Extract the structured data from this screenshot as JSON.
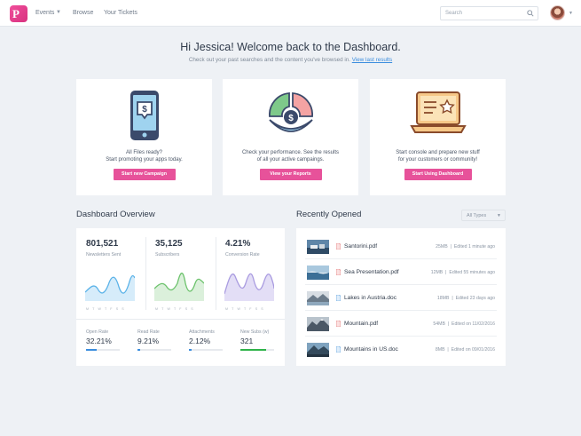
{
  "nav": {
    "items": [
      "Events",
      "Browse",
      "Your Tickets"
    ],
    "search_placeholder": "Search",
    "logo_letter": "P"
  },
  "welcome": {
    "title": "Hi Jessica! Welcome back to the Dashboard.",
    "subtitle": "Check out your past searches and the content you've browsed in.",
    "link": "View last results"
  },
  "cards": [
    {
      "line1": "All Files ready?",
      "line2": "Start promoting your apps today.",
      "button": "Start new Campaign",
      "icon": "mobile-dollar-icon"
    },
    {
      "line1": "Check your performance. See the results",
      "line2": "of all your active campaings.",
      "button": "View your Reports",
      "icon": "pie-dollar-icon"
    },
    {
      "line1": "Start console and prepare new stuff",
      "line2": "for your customers or community!",
      "button": "Start Using Dashboard",
      "icon": "laptop-star-icon"
    }
  ],
  "overview": {
    "title": "Dashboard Overview",
    "metrics": [
      {
        "value": "801,521",
        "label": "Newsletters Sent",
        "color": "#5ab2e8"
      },
      {
        "value": "35,125",
        "label": "Subscribers",
        "color": "#6cc26c"
      },
      {
        "value": "4.21%",
        "label": "Conversion Rate",
        "color": "#a99be0"
      }
    ],
    "days": "M T W T F S S",
    "stats": [
      {
        "label": "Open Rate",
        "value": "32.21%",
        "progress": 0.32,
        "color": "#3a8dde"
      },
      {
        "label": "Read Rate",
        "value": "9.21%",
        "progress": 0.09,
        "color": "#3a8dde"
      },
      {
        "label": "Attachments",
        "value": "2.12%",
        "progress": 0.08,
        "color": "#3a8dde"
      },
      {
        "label": "New Subs (w)",
        "value": "321",
        "progress": 0.75,
        "color": "#2fb34a"
      }
    ]
  },
  "recent": {
    "title": "Recently Opened",
    "filter": "All Types",
    "files": [
      {
        "name": "Santorini.pdf",
        "size": "25MB",
        "edited": "Edited 1 minute ago",
        "type": "pdf"
      },
      {
        "name": "Sea Presentation.pdf",
        "size": "12MB",
        "edited": "Edited 55 minutes ago",
        "type": "pdf"
      },
      {
        "name": "Lakes in Austria.doc",
        "size": "18MB",
        "edited": "Edited 23 days ago",
        "type": "doc"
      },
      {
        "name": "Mountain.pdf",
        "size": "54MB",
        "edited": "Edited on 11/02/2016",
        "type": "pdf"
      },
      {
        "name": "Mountains in US.doc",
        "size": "8MB",
        "edited": "Edited on 09/01/2016",
        "type": "doc"
      }
    ]
  },
  "colors": {
    "accent": "#e7529a",
    "link": "#3a8dde",
    "background": "#eef1f5"
  }
}
